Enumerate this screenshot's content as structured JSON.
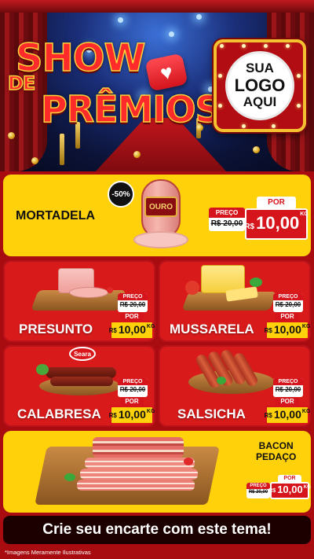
{
  "hero": {
    "title_line1": "SHOW",
    "title_line2": "DE",
    "title_line3": "PRÊMIOS",
    "logo_line1": "SUA",
    "logo_line2": "LOGO",
    "logo_line3": "AQUI"
  },
  "featured": {
    "name": "MORTADELA",
    "discount_badge": "-50%",
    "brand": "OURO",
    "old_label": "PREÇO",
    "old_price": "R$ 20,00",
    "new_label": "POR",
    "currency": "R$",
    "new_price": "10,00",
    "unit": "KG"
  },
  "products": [
    {
      "name": "PRESUNTO",
      "old_label": "PREÇO",
      "old_price": "R$ 20,00",
      "new_label": "POR",
      "currency": "R$",
      "new_price": "10,00",
      "unit": "KG"
    },
    {
      "name": "MUSSARELA",
      "old_label": "PREÇO",
      "old_price": "R$ 20,00",
      "new_label": "POR",
      "currency": "R$",
      "new_price": "10,00",
      "unit": "KG"
    },
    {
      "name": "CALABRESA",
      "brand": "Seara",
      "old_label": "PREÇO",
      "old_price": "R$ 20,00",
      "new_label": "POR",
      "currency": "R$",
      "new_price": "10,00",
      "unit": "KG"
    },
    {
      "name": "SALSICHA",
      "old_label": "PREÇO",
      "old_price": "R$ 20,00",
      "new_label": "POR",
      "currency": "R$",
      "new_price": "10,00",
      "unit": "KG"
    }
  ],
  "bacon": {
    "name_line1": "BACON",
    "name_line2": "PEDAÇO",
    "old_label": "PREÇO",
    "old_price": "R$ 20,00",
    "new_label": "POR",
    "currency": "R$",
    "new_price": "10,00",
    "unit": "KG"
  },
  "cta": {
    "label": "Crie seu encarte com este tema!"
  },
  "footnote": "*Imagens Meramente Ilustrativas",
  "colors": {
    "yellow": "#ffd10a",
    "red": "#d81a1a",
    "dark_red": "#a80c10",
    "black": "#1c0000"
  }
}
